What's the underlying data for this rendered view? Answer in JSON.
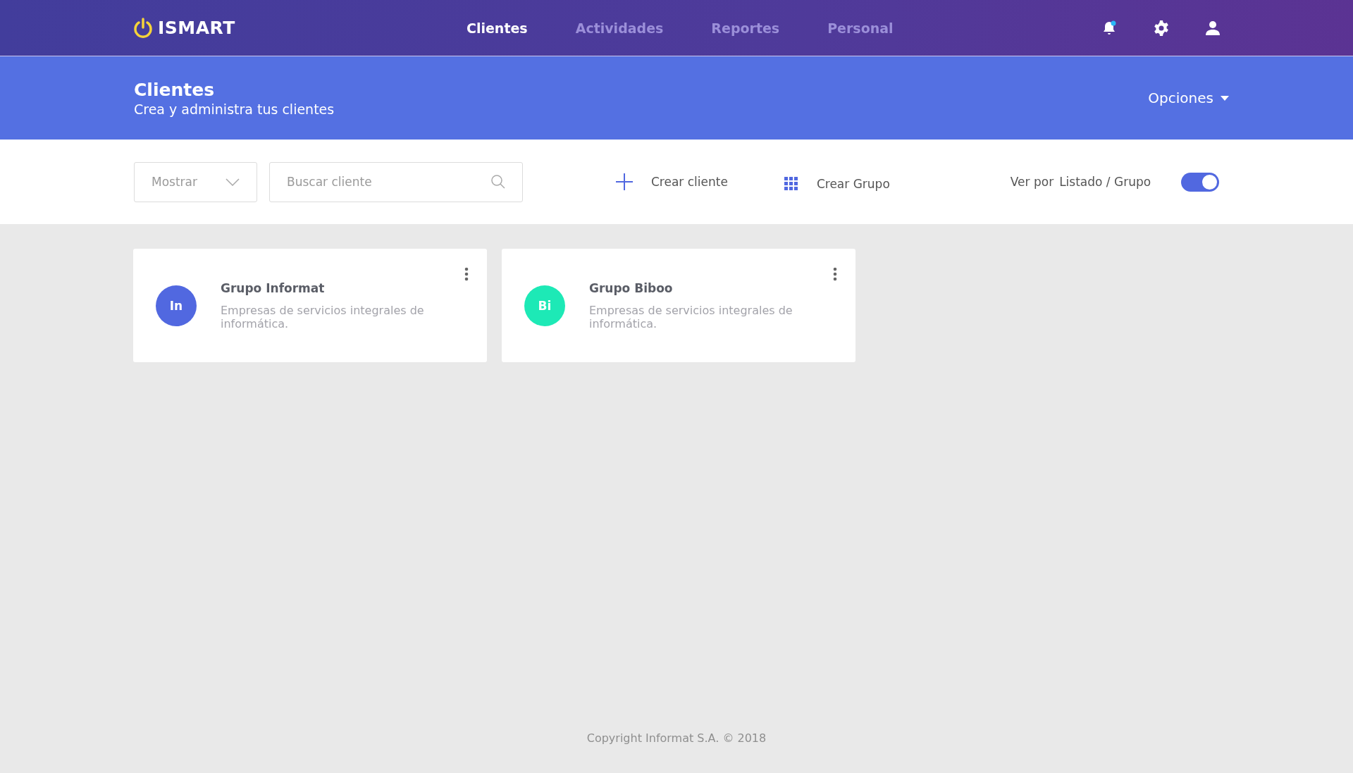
{
  "brand": {
    "name": "ISMART"
  },
  "nav": [
    {
      "label": "Clientes",
      "selected": true
    },
    {
      "label": "Actividades",
      "selected": false
    },
    {
      "label": "Reportes",
      "selected": false
    },
    {
      "label": "Personal",
      "selected": false
    }
  ],
  "header": {
    "title": "Clientes",
    "subtitle": "Crea y administra tus clientes",
    "options": "Opciones"
  },
  "toolbar": {
    "show_select": "Mostrar",
    "search": {
      "placeholder": "Buscar cliente"
    },
    "create_client": "Crear cliente",
    "create_group": "Crear Grupo",
    "view_label": "Ver por",
    "view_options": "Listado / Grupo",
    "view_toggle": {
      "on": true
    }
  },
  "cards": [
    {
      "initials": "In",
      "color": "#5168e0",
      "title": "Grupo Informat",
      "description": "Empresas de servicios integrales de informática."
    },
    {
      "initials": "Bi",
      "color": "#1de9b6",
      "title": "Grupo Biboo",
      "description": "Empresas de servicios integrales de informática."
    }
  ],
  "footer": "Copyright Informat S.A. © 2018"
}
